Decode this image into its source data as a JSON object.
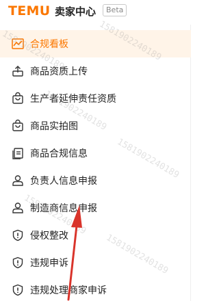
{
  "header": {
    "logo": "TEMU",
    "title": "卖家中心",
    "badge": "Beta"
  },
  "sidebar": {
    "items": [
      {
        "label": "合规看板",
        "icon": "chart-line-icon",
        "active": true
      },
      {
        "label": "商品资质上传",
        "icon": "upload-icon",
        "active": false
      },
      {
        "label": "生产者延伸责任资质",
        "icon": "bag-icon",
        "active": false
      },
      {
        "label": "商品实拍图",
        "icon": "bag-icon",
        "active": false
      },
      {
        "label": "商品合规信息",
        "icon": "document-icon",
        "active": false
      },
      {
        "label": "负责人信息申报",
        "icon": "person-icon",
        "active": false
      },
      {
        "label": "制造商信息申报",
        "icon": "person-icon",
        "active": false
      },
      {
        "label": "侵权整改",
        "icon": "shield-alert-icon",
        "active": false
      },
      {
        "label": "违规申诉",
        "icon": "shield-alert-icon",
        "active": false
      },
      {
        "label": "违规处理商家申诉",
        "icon": "shield-alert-icon",
        "active": false
      }
    ]
  },
  "watermark": "15819022401​89",
  "colors": {
    "accent": "#fb7701",
    "active_bg": "#fff4e8",
    "annotation_arrow": "#d9342b"
  }
}
